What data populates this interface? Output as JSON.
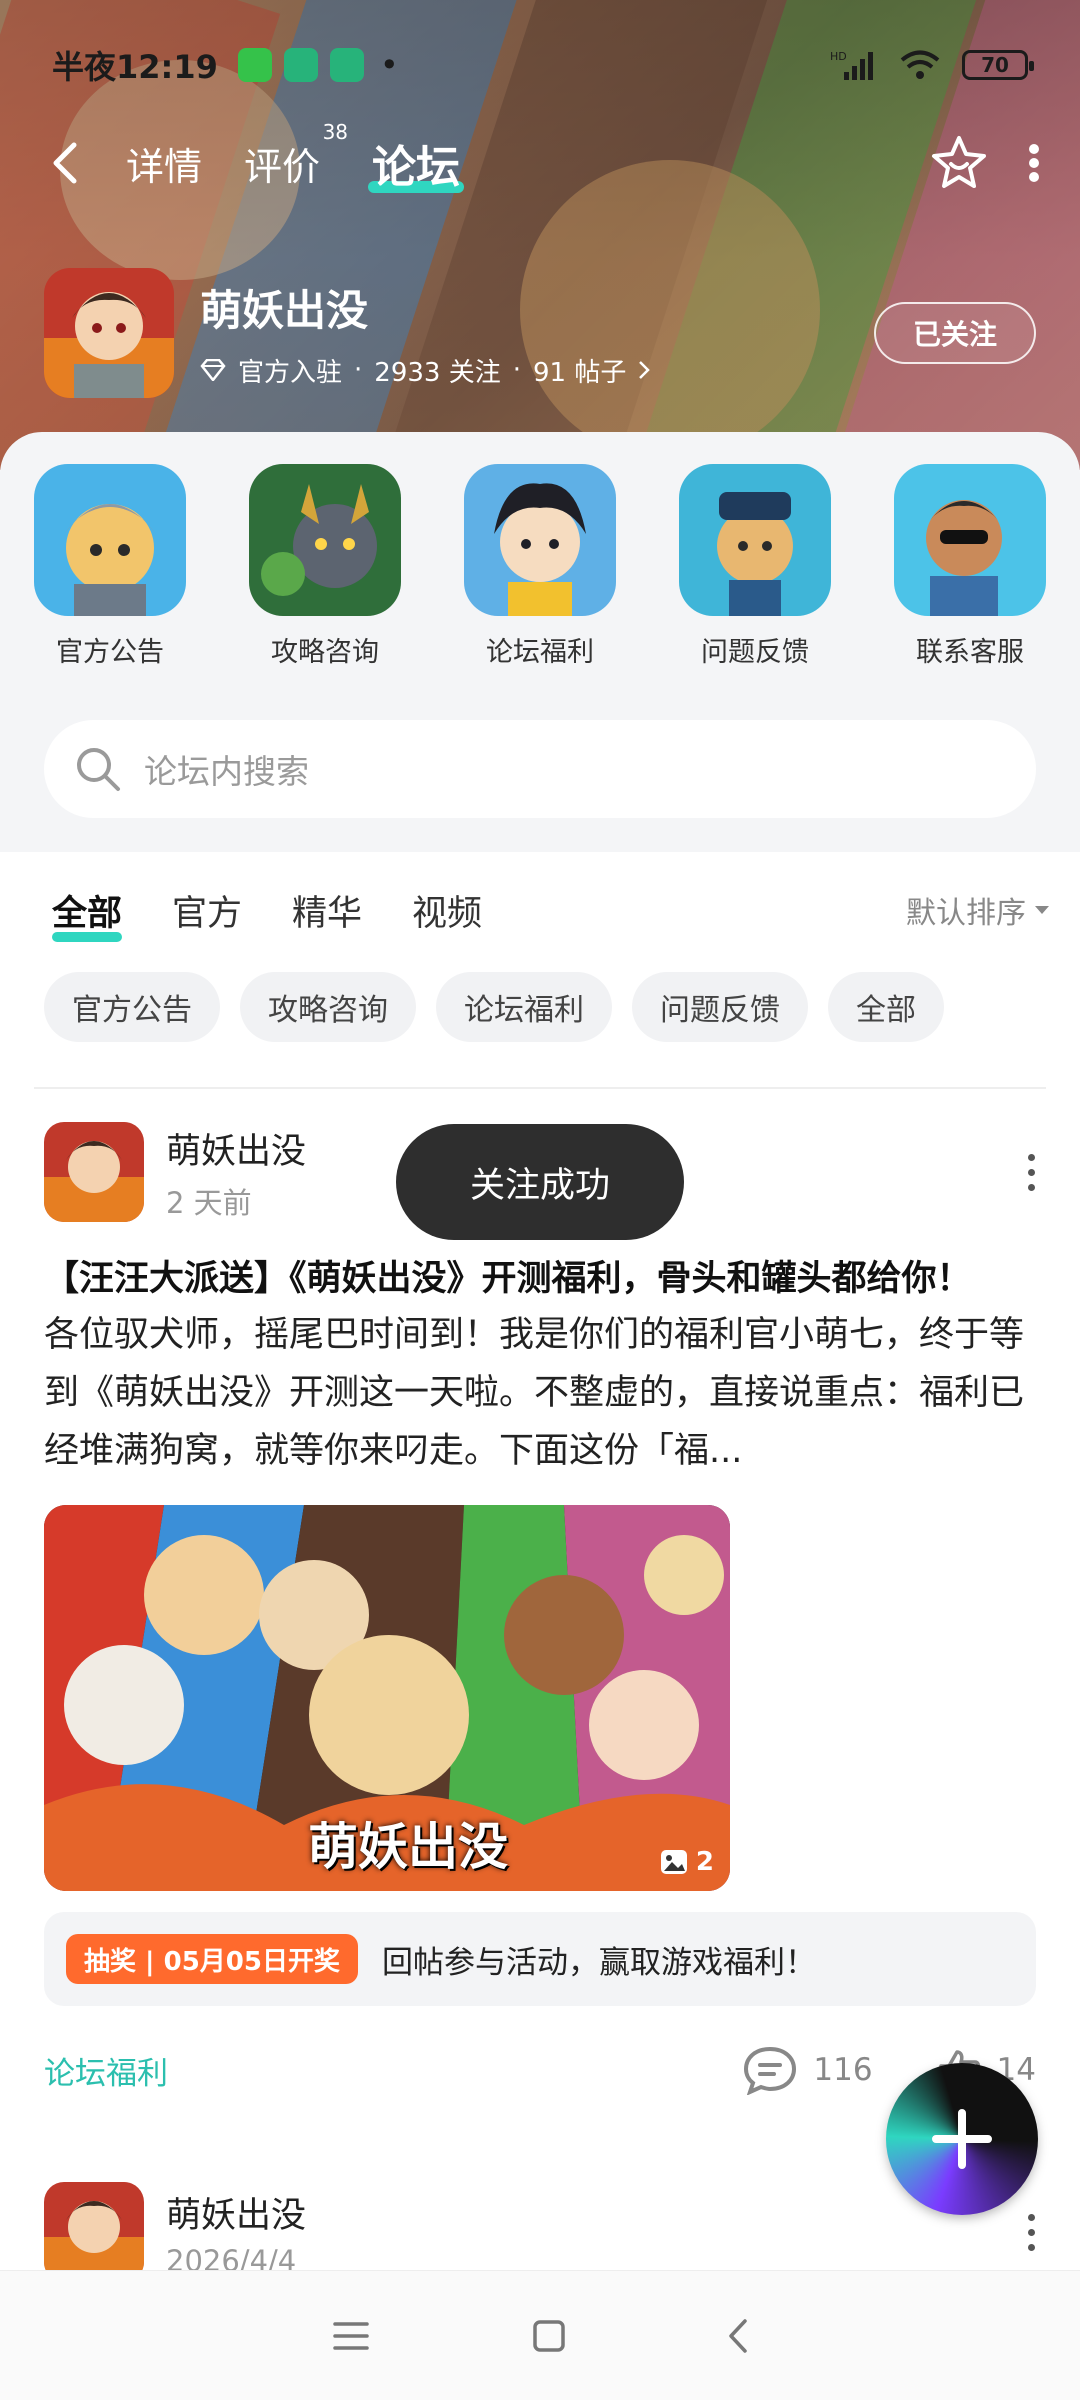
{
  "status_bar": {
    "time": "半夜12:19",
    "battery": "70",
    "network": "HD"
  },
  "nav": {
    "tabs": [
      {
        "label": "详情"
      },
      {
        "label": "评价",
        "badge": "38"
      },
      {
        "label": "论坛"
      }
    ],
    "active_tab": "论坛"
  },
  "game": {
    "name": "萌妖出没",
    "official": "官方入驻",
    "followers": "2933 关注",
    "posts": "91 帖子",
    "follow_button": "已关注"
  },
  "shortcuts": [
    {
      "label": "官方公告"
    },
    {
      "label": "攻略咨询"
    },
    {
      "label": "论坛福利"
    },
    {
      "label": "问题反馈"
    },
    {
      "label": "联系客服"
    }
  ],
  "search": {
    "placeholder": "论坛内搜索"
  },
  "filter_tabs": [
    {
      "label": "全部"
    },
    {
      "label": "官方"
    },
    {
      "label": "精华"
    },
    {
      "label": "视频"
    }
  ],
  "sort": "默认排序",
  "chips": [
    {
      "label": "官方公告"
    },
    {
      "label": "攻略咨询"
    },
    {
      "label": "论坛福利"
    },
    {
      "label": "问题反馈"
    },
    {
      "label": "全部"
    }
  ],
  "post": {
    "author": "萌妖出没",
    "time": "2 天前",
    "title": "【汪汪大派送】《萌妖出没》开测福利，骨头和罐头都给你！",
    "body": "各位驭犬师，摇尾巴时间到！我是你们的福利官小萌七，终于等到《萌妖出没》开测这一天啦。不整虚的，直接说重点：福利已经堆满狗窝，就等你来叼走。下面这份「福...",
    "image_logo": "萌妖出没",
    "image_count": "2",
    "lottery_tag": "抽奖 | 05月05日开奖",
    "lottery_text": "回帖参与活动，赢取游戏福利！",
    "board": "论坛福利",
    "comments": "116",
    "likes": "14"
  },
  "post2": {
    "author": "萌妖出没",
    "time": "2026/4/4"
  },
  "toast": "关注成功",
  "colors": {
    "accent": "#2fd6c0",
    "board_link": "#2bbfae",
    "lottery": "#ff6a2d"
  }
}
